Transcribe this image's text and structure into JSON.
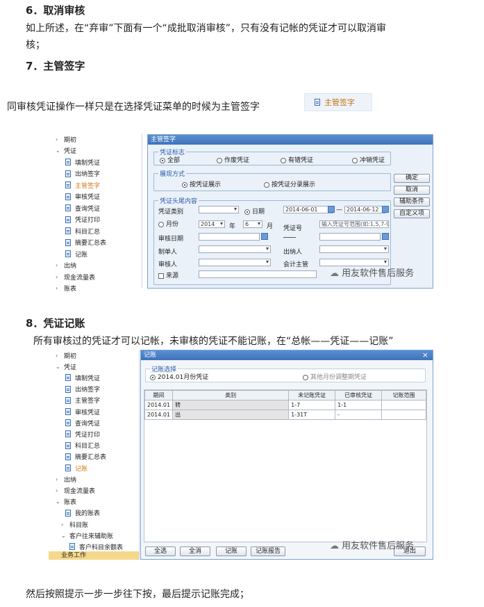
{
  "section6": {
    "heading": "6．取消审核",
    "line1": "如上所述，在“弃审”下面有一个“成批取消审核”，只有没有记帐的凭证才可以取消审",
    "line2": "核；"
  },
  "section7": {
    "heading": "7．主管签字",
    "intro": "同审核凭证操作一样只是在选择凭证菜单的时候为主管签字",
    "menu_button": "主管签字"
  },
  "tree1": {
    "items": [
      {
        "label": "期初",
        "type": "folder"
      },
      {
        "label": "凭证",
        "type": "folder-open"
      },
      {
        "label": "填制凭证",
        "type": "doc"
      },
      {
        "label": "出纳签字",
        "type": "doc"
      },
      {
        "label": "主管签字",
        "type": "doc",
        "active": true
      },
      {
        "label": "审核凭证",
        "type": "doc"
      },
      {
        "label": "查询凭证",
        "type": "doc"
      },
      {
        "label": "凭证打印",
        "type": "doc"
      },
      {
        "label": "科目汇总",
        "type": "doc"
      },
      {
        "label": "摘要汇总表",
        "type": "doc"
      },
      {
        "label": "记账",
        "type": "doc"
      },
      {
        "label": "出纳",
        "type": "folder"
      },
      {
        "label": "现金流量表",
        "type": "folder"
      },
      {
        "label": "账表",
        "type": "folder"
      }
    ]
  },
  "dialog1": {
    "title": "主管签字",
    "voucher_flag": {
      "legend": "凭证标志",
      "options": [
        "全部",
        "作废凭证",
        "有错凭证",
        "冲销凭证"
      ],
      "selected": "全部"
    },
    "display_mode": {
      "legend": "展现方式",
      "options": [
        "按凭证展示",
        "按凭证分录展示"
      ],
      "selected": "按凭证展示"
    },
    "header": {
      "legend": "凭证头尾内容",
      "voucher_type_label": "凭证类别",
      "date_label": "日期",
      "date_from": "2014-06-01",
      "dash": "—",
      "date_to": "2014-06-12",
      "month_label": "月份",
      "year_value": "2014",
      "year_unit": "年",
      "month_value": "6",
      "month_unit": "月",
      "voucher_no_label": "凭证号",
      "voucher_no_placeholder": "输入凭证号范围(如:1,5,7-9",
      "audit_date_label": "审核日期",
      "maker_label": "制单人",
      "cashier_label": "出纳人",
      "auditor_label": "审核人",
      "supervisor_label": "会计主管",
      "source_label": "来源"
    },
    "buttons": [
      "确定",
      "取消",
      "辅助条件",
      "自定义项"
    ]
  },
  "watermark": "用友软件售后服务",
  "section8": {
    "heading": "8．凭证记账",
    "intro": "所有审核过的凭证才可以记帐，未审核的凭证不能记账，在“总帐——凭证——记账”"
  },
  "tree2": {
    "items": [
      {
        "label": "期初",
        "type": "folder"
      },
      {
        "label": "凭证",
        "type": "folder-open"
      },
      {
        "label": "填制凭证",
        "type": "doc"
      },
      {
        "label": "出纳签字",
        "type": "doc"
      },
      {
        "label": "主管签字",
        "type": "doc"
      },
      {
        "label": "审核凭证",
        "type": "doc"
      },
      {
        "label": "查询凭证",
        "type": "doc"
      },
      {
        "label": "凭证打印",
        "type": "doc"
      },
      {
        "label": "科目汇总",
        "type": "doc"
      },
      {
        "label": "摘要汇总表",
        "type": "doc"
      },
      {
        "label": "记账",
        "type": "doc",
        "active": true
      },
      {
        "label": "出纳",
        "type": "folder"
      },
      {
        "label": "现金流量表",
        "type": "folder"
      },
      {
        "label": "账表",
        "type": "folder-open"
      },
      {
        "label": "我的账表",
        "type": "doc"
      },
      {
        "label": "科目账",
        "type": "folder"
      },
      {
        "label": "客户往来辅助账",
        "type": "folder-open"
      },
      {
        "label": "客户科目余额表",
        "type": "doc"
      }
    ],
    "bottom": "业务工作"
  },
  "dialog2": {
    "title": "记账",
    "close": "×",
    "select_legend": "记账选择",
    "option1": "2014.01月份凭证",
    "option2": "其他月份调整期凭证",
    "columns": [
      "期间",
      "类别",
      "未记账凭证",
      "已审核凭证",
      "记账范围"
    ],
    "rows": [
      [
        "2014.01",
        "转",
        "1-7",
        "1-1",
        ""
      ],
      [
        "2014.01",
        "出",
        "1-31T",
        "-",
        ""
      ]
    ],
    "buttons": [
      "全选",
      "全消",
      "记账",
      "记账报告"
    ],
    "exit": "退出"
  },
  "closing": "然后按照提示一步一步往下按，最后提示记账完成；"
}
